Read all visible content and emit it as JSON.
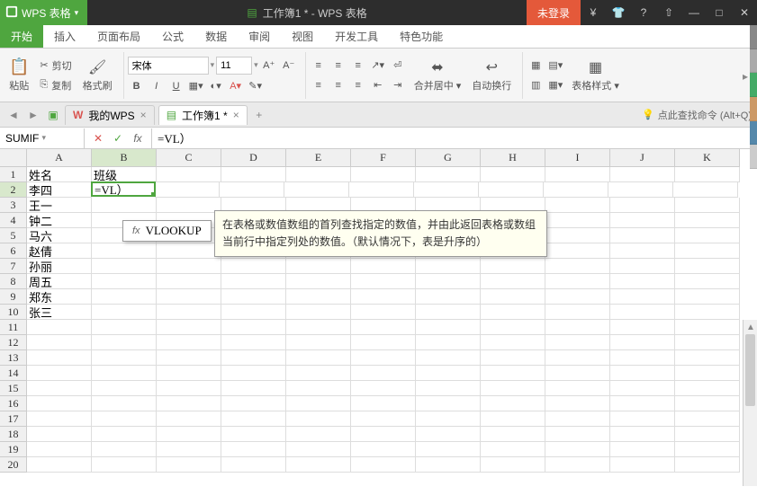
{
  "title": {
    "app": "WPS 表格",
    "doc": "工作簿1 * - WPS 表格",
    "login": "未登录"
  },
  "menu": {
    "start": "开始",
    "insert": "插入",
    "pagelayout": "页面布局",
    "formula": "公式",
    "data": "数据",
    "review": "审阅",
    "view": "视图",
    "dev": "开发工具",
    "special": "特色功能"
  },
  "ribbon": {
    "cut": "剪切",
    "copy": "复制",
    "paste": "粘贴",
    "formatpainter": "格式刷",
    "font_name": "宋体",
    "font_size": "11",
    "merge": "合并居中",
    "wrap": "自动换行",
    "cellstyle": "表格样式"
  },
  "tabs": {
    "mywps": "我的WPS",
    "book1": "工作簿1 *",
    "hint": "点此查找命令 (Alt+Q)"
  },
  "formula": {
    "name": "SUMIF",
    "input": "=VL）"
  },
  "columns": [
    "A",
    "B",
    "C",
    "D",
    "E",
    "F",
    "G",
    "H",
    "I",
    "J",
    "K"
  ],
  "rows_count": 20,
  "cells": {
    "A1": "姓名",
    "B1": "班级",
    "A2": "李四",
    "B2": "=VL）",
    "A3": "王一",
    "A4": "钟二",
    "A5": "马六",
    "A6": "赵倩",
    "A7": "孙丽",
    "A8": "周五",
    "A9": "郑东",
    "A10": "张三"
  },
  "suggest": {
    "name": "VLOOKUP"
  },
  "tooltip": "在表格或数值数组的首列查找指定的数值，并由此返回表格或数组当前行中指定列处的数值。（默认情况下，表是升序的）"
}
